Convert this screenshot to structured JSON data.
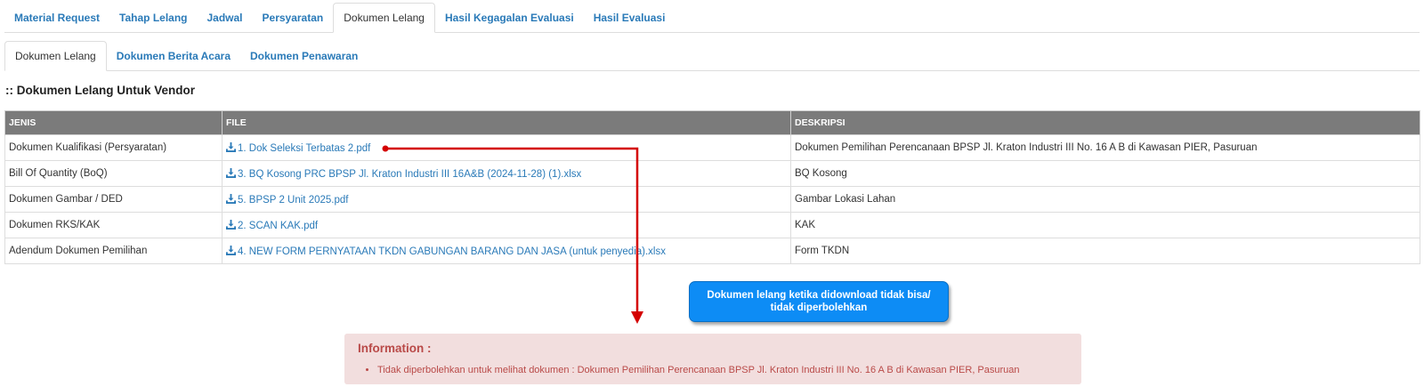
{
  "tabs_top": [
    {
      "label": "Material Request",
      "active": false
    },
    {
      "label": "Tahap Lelang",
      "active": false
    },
    {
      "label": "Jadwal",
      "active": false
    },
    {
      "label": "Persyaratan",
      "active": false
    },
    {
      "label": "Dokumen Lelang",
      "active": true
    },
    {
      "label": "Hasil Kegagalan Evaluasi",
      "active": false
    },
    {
      "label": "Hasil Evaluasi",
      "active": false
    }
  ],
  "tabs_sub": [
    {
      "label": "Dokumen Lelang",
      "active": true
    },
    {
      "label": "Dokumen Berita Acara",
      "active": false
    },
    {
      "label": "Dokumen Penawaran",
      "active": false
    }
  ],
  "section_title": ":: Dokumen Lelang Untuk Vendor",
  "table": {
    "headers": {
      "jenis": "JENIS",
      "file": "FILE",
      "deskripsi": "DESKRIPSI"
    },
    "rows": [
      {
        "jenis": "Dokumen Kualifikasi (Persyaratan)",
        "file": "1. Dok Seleksi Terbatas 2.pdf",
        "deskripsi": "Dokumen Pemilihan Perencanaan BPSP Jl. Kraton Industri III No. 16 A B di Kawasan PIER, Pasuruan"
      },
      {
        "jenis": "Bill Of Quantity (BoQ)",
        "file": "3. BQ Kosong PRC BPSP Jl. Kraton Industri III 16A&B (2024-11-28) (1).xlsx",
        "deskripsi": "BQ Kosong"
      },
      {
        "jenis": "Dokumen Gambar / DED",
        "file": "5. BPSP 2 Unit 2025.pdf",
        "deskripsi": "Gambar Lokasi Lahan"
      },
      {
        "jenis": "Dokumen RKS/KAK",
        "file": "2. SCAN KAK.pdf",
        "deskripsi": "KAK"
      },
      {
        "jenis": "Adendum Dokumen Pemilihan",
        "file": "4. NEW FORM PERNYATAAN TKDN GABUNGAN BARANG DAN JASA (untuk penyedia).xlsx",
        "deskripsi": "Form TKDN"
      }
    ]
  },
  "callout": {
    "line1": "Dokumen lelang ketika didownload tidak bisa/",
    "line2": "tidak diperbolehkan"
  },
  "info": {
    "title": "Information :",
    "message": "Tidak diperbolehkan untuk melihat dokumen : Dokumen Pemilihan Perencanaan BPSP Jl. Kraton Industri III No. 16 A B di Kawasan PIER, Pasuruan"
  },
  "colors": {
    "link": "#2a7ab8",
    "header_bg": "#7b7b7b",
    "arrow": "#d40000",
    "callout_bg": "#0d8cf5",
    "info_bg": "#f2dede",
    "info_text": "#b94a48"
  },
  "icons": {
    "file_link": "download-icon"
  }
}
